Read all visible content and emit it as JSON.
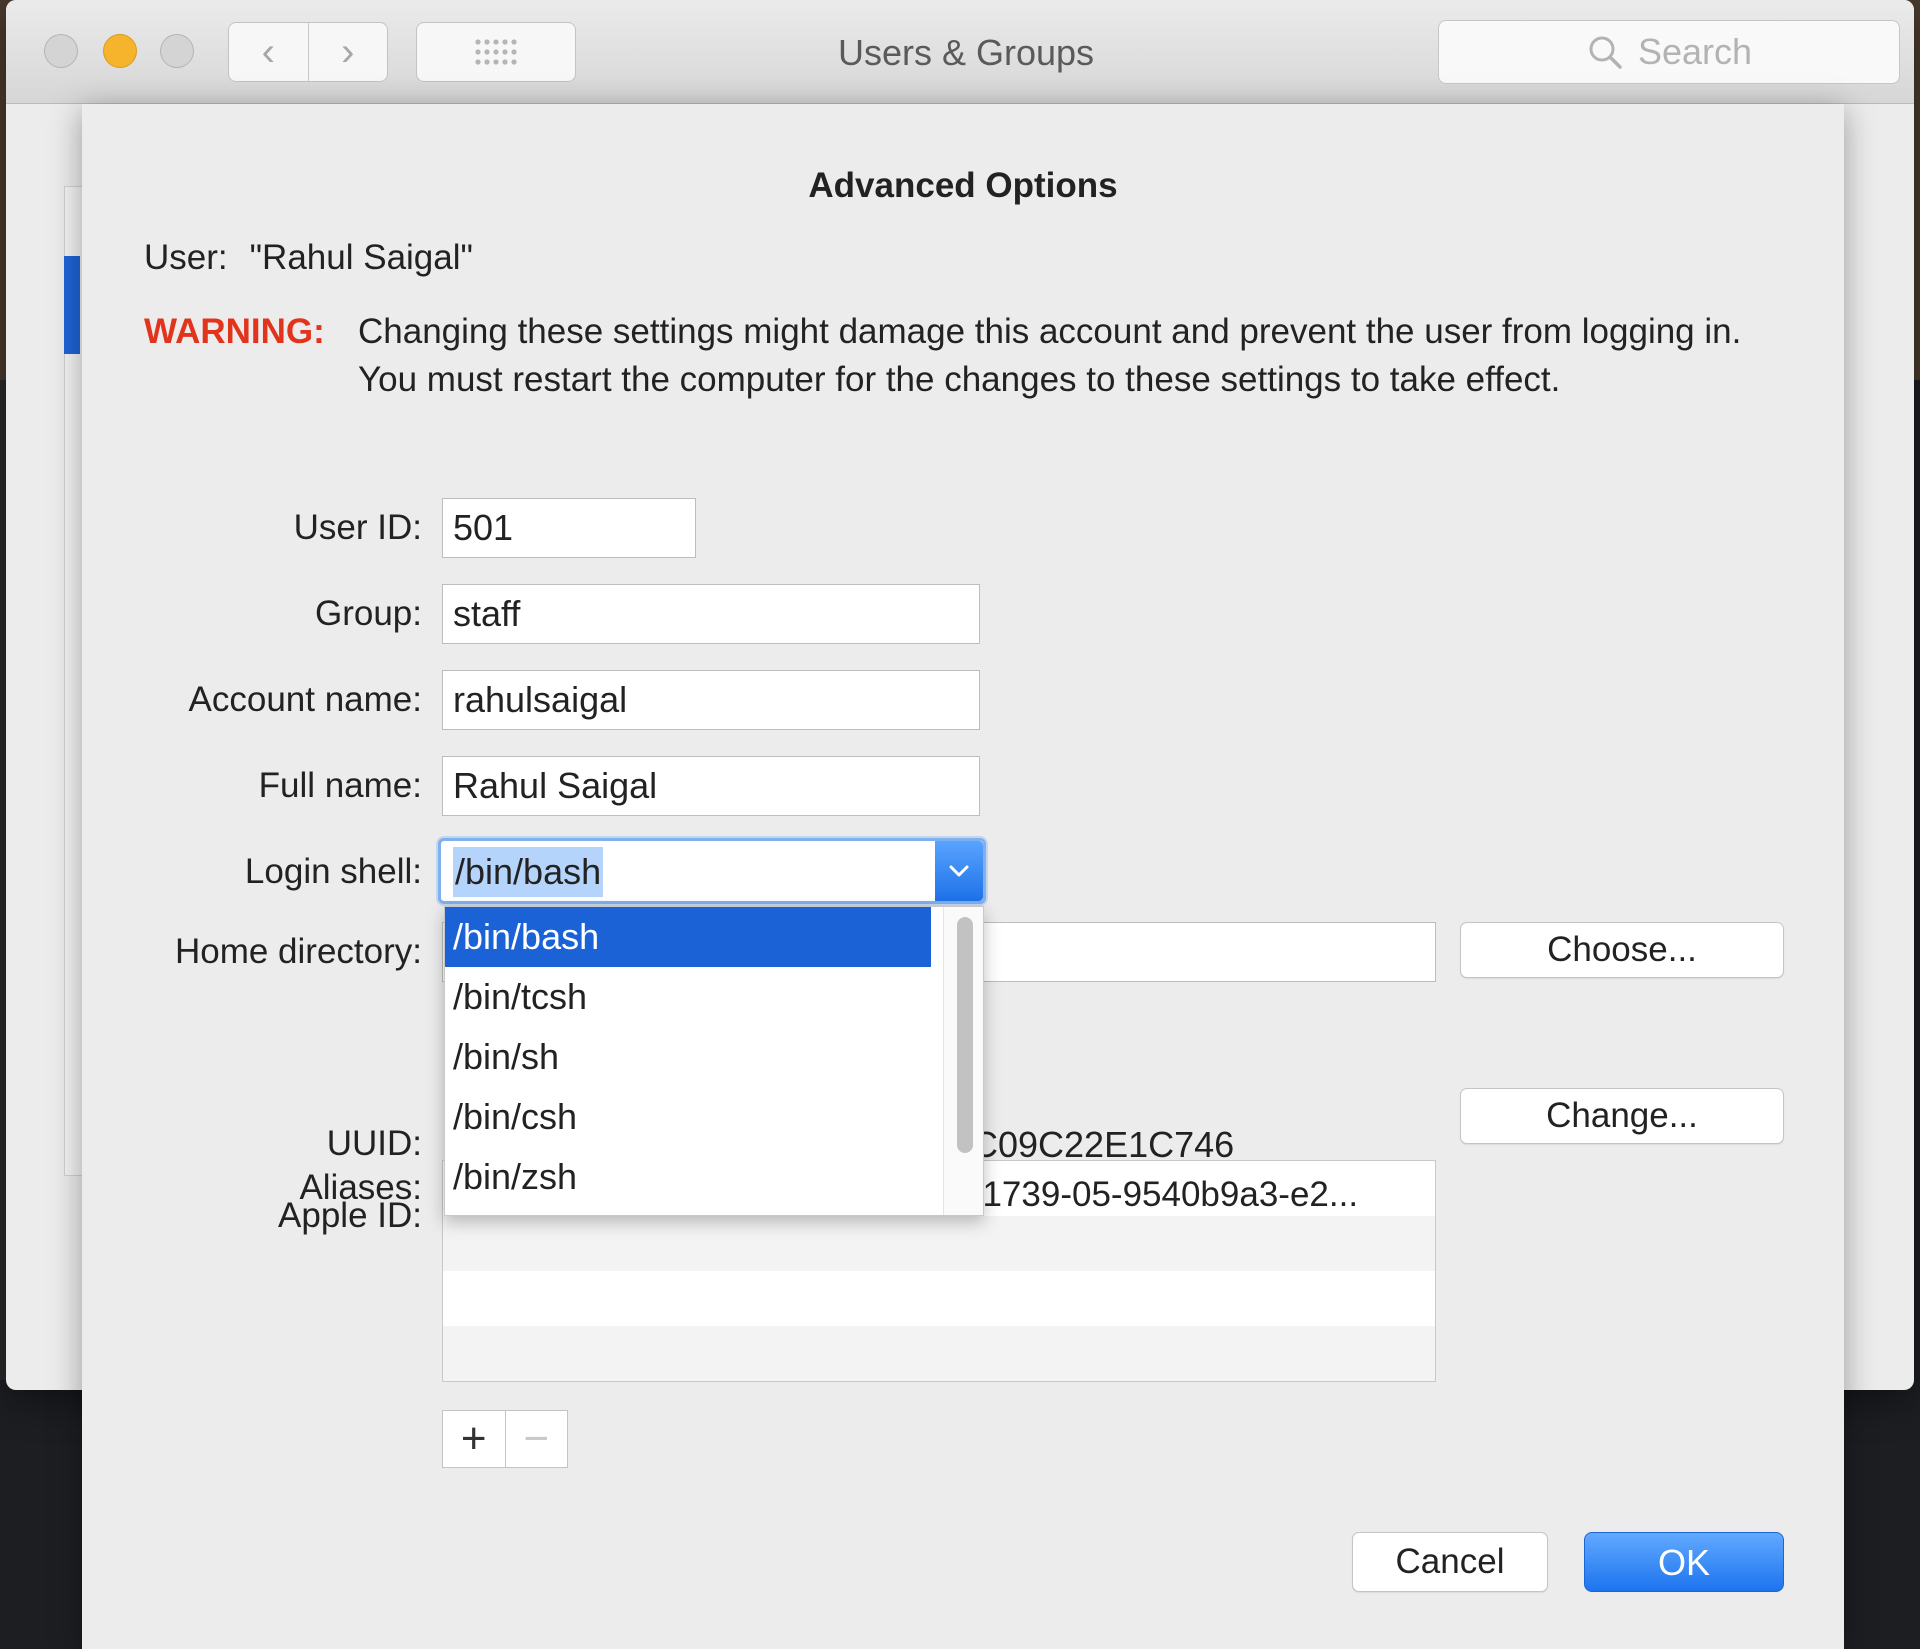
{
  "window": {
    "title": "Users & Groups",
    "nav_back": "‹",
    "nav_forward": "›",
    "search_placeholder": "Search"
  },
  "sheet": {
    "title": "Advanced Options",
    "user_label": "User:",
    "user_value": "\"Rahul Saigal\"",
    "warning_label": "WARNING:",
    "warning_text": "Changing these settings might damage this account and prevent the user from logging in. You must restart the computer for the changes to these settings to take effect."
  },
  "fields": {
    "user_id": {
      "label": "User ID:",
      "value": "501"
    },
    "group": {
      "label": "Group:",
      "value": "staff"
    },
    "account_name": {
      "label": "Account name:",
      "value": "rahulsaigal"
    },
    "full_name": {
      "label": "Full name:",
      "value": "Rahul Saigal"
    },
    "login_shell": {
      "label": "Login shell:",
      "value": "/bin/bash"
    },
    "home_directory": {
      "label": "Home directory:",
      "button": "Choose..."
    },
    "uuid": {
      "label": "UUID:",
      "value_visible": "C09C22E1C746"
    },
    "apple_id": {
      "label": "Apple ID:",
      "button": "Change..."
    },
    "aliases": {
      "label": "Aliases:",
      "first_alias_visible": "01739-05-9540b9a3-e2..."
    }
  },
  "dropdown": {
    "options": [
      "/bin/bash",
      "/bin/tcsh",
      "/bin/sh",
      "/bin/csh",
      "/bin/zsh"
    ],
    "selected": "/bin/bash"
  },
  "aliases_buttons": {
    "add": "+",
    "remove": "−"
  },
  "footer": {
    "cancel": "Cancel",
    "ok": "OK"
  },
  "colors": {
    "accent": "#1d74ef",
    "warning": "#e2341d",
    "selection": "#1a62d6",
    "minimize": "#f6b32c"
  }
}
